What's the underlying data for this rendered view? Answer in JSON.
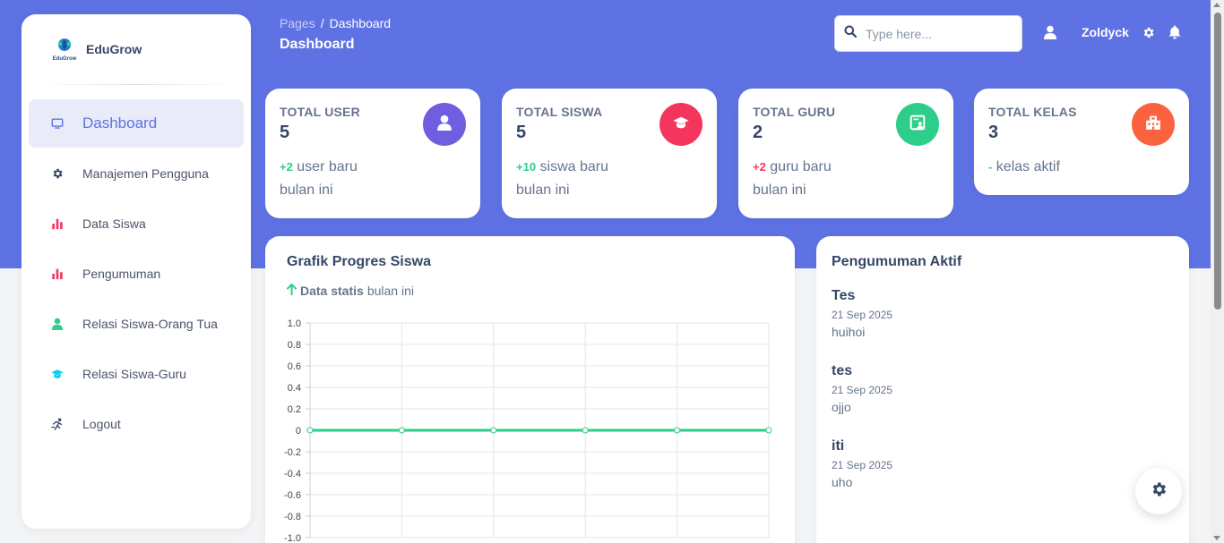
{
  "brand": {
    "name": "EduGrow",
    "logo_text": "EduGrow"
  },
  "sidebar": {
    "items": [
      {
        "label": "Dashboard",
        "icon": "monitor-icon",
        "color": "#5e72e4",
        "active": true
      },
      {
        "label": "Manajemen Pengguna",
        "icon": "gear-icon",
        "color": "#344767",
        "active": false
      },
      {
        "label": "Data Siswa",
        "icon": "bar-chart-icon",
        "color": "#f5365c",
        "active": false
      },
      {
        "label": "Pengumuman",
        "icon": "bar-chart-icon",
        "color": "#f5365c",
        "active": false
      },
      {
        "label": "Relasi Siswa-Orang Tua",
        "icon": "user-icon",
        "color": "#2dce89",
        "active": false
      },
      {
        "label": "Relasi Siswa-Guru",
        "icon": "graduation-cap-icon",
        "color": "#11cdef",
        "active": false
      },
      {
        "label": "Logout",
        "icon": "running-icon",
        "color": "#344767",
        "active": false
      }
    ]
  },
  "header": {
    "breadcrumb_root": "Pages",
    "breadcrumb_sep": "/",
    "breadcrumb_current": "Dashboard",
    "title": "Dashboard",
    "search_placeholder": "Type here...",
    "user_name": "Zoldyck"
  },
  "stats": [
    {
      "title": "TOTAL USER",
      "value": "5",
      "delta": "+2",
      "delta_color": "green",
      "desc": " user baru bulan ini",
      "icon": "user-icon",
      "badge_color": "#6f5fe0"
    },
    {
      "title": "TOTAL SISWA",
      "value": "5",
      "delta": "+10",
      "delta_color": "green",
      "desc": " siswa baru bulan ini",
      "icon": "graduation-cap-icon",
      "badge_color": "#f5365c"
    },
    {
      "title": "TOTAL GURU",
      "value": "2",
      "delta": "+2",
      "delta_color": "red",
      "desc": " guru baru bulan ini",
      "icon": "teacher-board-icon",
      "badge_color": "#2dce89"
    },
    {
      "title": "TOTAL KELAS",
      "value": "3",
      "delta": "-",
      "delta_color": "green",
      "desc": " kelas aktif",
      "icon": "building-icon",
      "badge_color": "#fb6340"
    }
  ],
  "chart_card": {
    "title": "Grafik Progres Siswa",
    "sub_bold": "Data statis",
    "sub_rest": "bulan ini"
  },
  "chart_data": {
    "type": "line",
    "x": [
      0,
      1,
      2,
      3,
      4,
      5
    ],
    "series": [
      {
        "values": [
          0,
          0,
          0,
          0,
          0,
          0
        ],
        "color": "#2dce89"
      }
    ],
    "ylim": [
      -1.0,
      1.0
    ],
    "yticks": [
      "1.0",
      "0.8",
      "0.6",
      "0.4",
      "0.2",
      "0",
      "-0.2",
      "-0.4",
      "-0.6",
      "-0.8",
      "-1.0"
    ],
    "grid": true
  },
  "announcements": {
    "title": "Pengumuman Aktif",
    "items": [
      {
        "title": "Tes",
        "date": "21 Sep 2025",
        "body": "huihoi"
      },
      {
        "title": "tes",
        "date": "21 Sep 2025",
        "body": "ojjo"
      },
      {
        "title": "iti",
        "date": "21 Sep 2025",
        "body": "uho"
      }
    ]
  }
}
